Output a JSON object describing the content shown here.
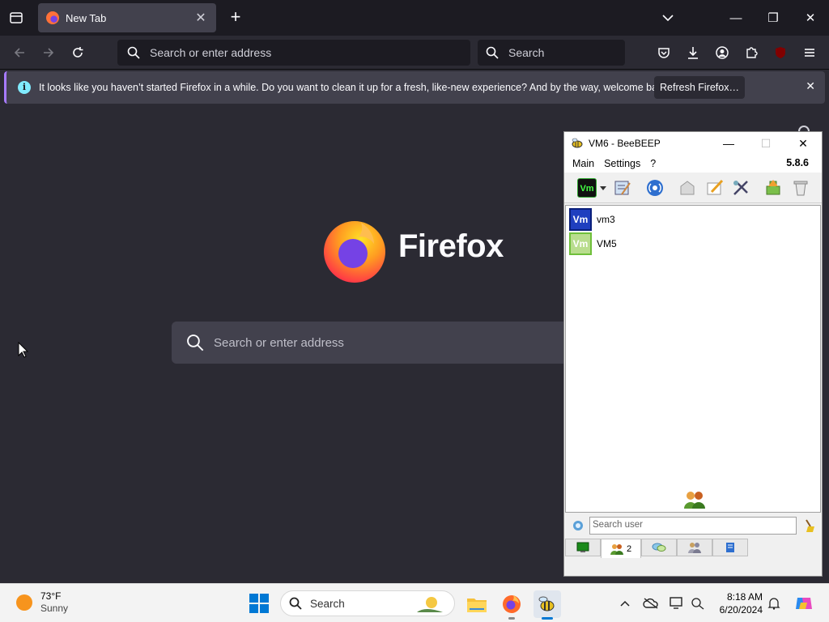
{
  "browser": {
    "tab_title": "New Tab",
    "url_placeholder": "Search or enter address",
    "search_placeholder": "Search",
    "notification": {
      "message": "It looks like you haven’t started Firefox in a while. Do you want to clean it up for a fresh, like-new experience? And by the way, welcome back!",
      "button": "Refresh Firefox…"
    },
    "brand": "Firefox",
    "content_search_placeholder": "Search or enter address",
    "colors": {
      "accent": "#a77bff",
      "info": "#80ebff",
      "toolbar": "#2b2a33",
      "tabstrip": "#1c1b22"
    }
  },
  "beebeep": {
    "title": "VM6 - BeeBEEP",
    "menu": [
      "Main",
      "Settings",
      "?"
    ],
    "version": "5.8.6",
    "users": [
      {
        "avatar": "Vm",
        "name": "vm3",
        "color": "#1f3fbf"
      },
      {
        "avatar": "Vm",
        "name": "VM5",
        "color": "#8bc34a"
      }
    ],
    "search_placeholder": "Search user",
    "tabs": [
      {
        "icon": "chat-screen-icon"
      },
      {
        "icon": "users-icon",
        "count": "2"
      },
      {
        "icon": "chats-icon"
      },
      {
        "icon": "groups-icon"
      },
      {
        "icon": "log-icon"
      }
    ]
  },
  "taskbar": {
    "weather": {
      "temp": "73°F",
      "condition": "Sunny"
    },
    "search_placeholder": "Search",
    "time": "8:18 AM",
    "date": "6/20/2024"
  }
}
